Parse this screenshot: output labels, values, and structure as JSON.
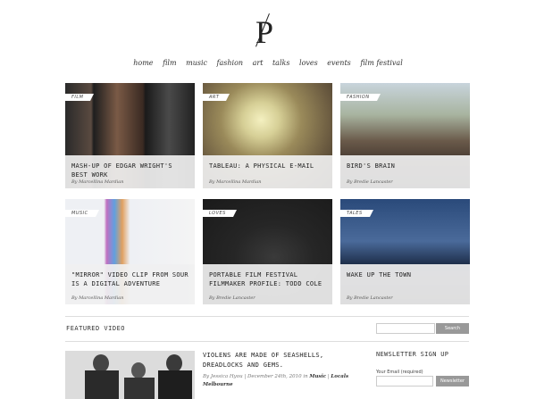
{
  "nav": [
    "home",
    "film",
    "music",
    "fashion",
    "art",
    "talks",
    "loves",
    "events",
    "film festival"
  ],
  "tiles": [
    {
      "tag": "FILM",
      "title": "Mash-up of Edgar Wright's best work",
      "byline": "By Marcellina Mardian"
    },
    {
      "tag": "ART",
      "title": "Tableau: a physical e-mail",
      "byline": "By Marcellina Mardian"
    },
    {
      "tag": "FASHION",
      "title": "Bird's Brain",
      "byline": "By Bredie Lancaster"
    },
    {
      "tag": "MUSIC",
      "title": "\"Mirror\" video clip from Sour is a digital adventure",
      "byline": "By Marcellina Mardian"
    },
    {
      "tag": "LOVES",
      "title": "Portable film festival filmmaker profile: Todd Cole",
      "byline": "By Bredie Lancaster"
    },
    {
      "tag": "TALES",
      "title": "Wake up the town",
      "byline": "By Bredie Lancaster"
    }
  ],
  "featured": {
    "heading": "FEATURED VIDEO",
    "post_title": "Violens are made of seashells, dreadlocks and gems.",
    "meta_by": "By Jessica Hyou",
    "meta_date": "December 24th, 2010 in",
    "meta_cat1": "Music",
    "meta_cat2": "Locals Melbourne"
  },
  "search": {
    "button": "Search"
  },
  "newsletter": {
    "heading": "NEWSLETTER SIGN UP",
    "label": "Your Email (required)",
    "button": "Newsletter"
  },
  "colors": {
    "button": "#999999",
    "caption_bg": "#f0f0f0",
    "rule": "#dddddd"
  }
}
